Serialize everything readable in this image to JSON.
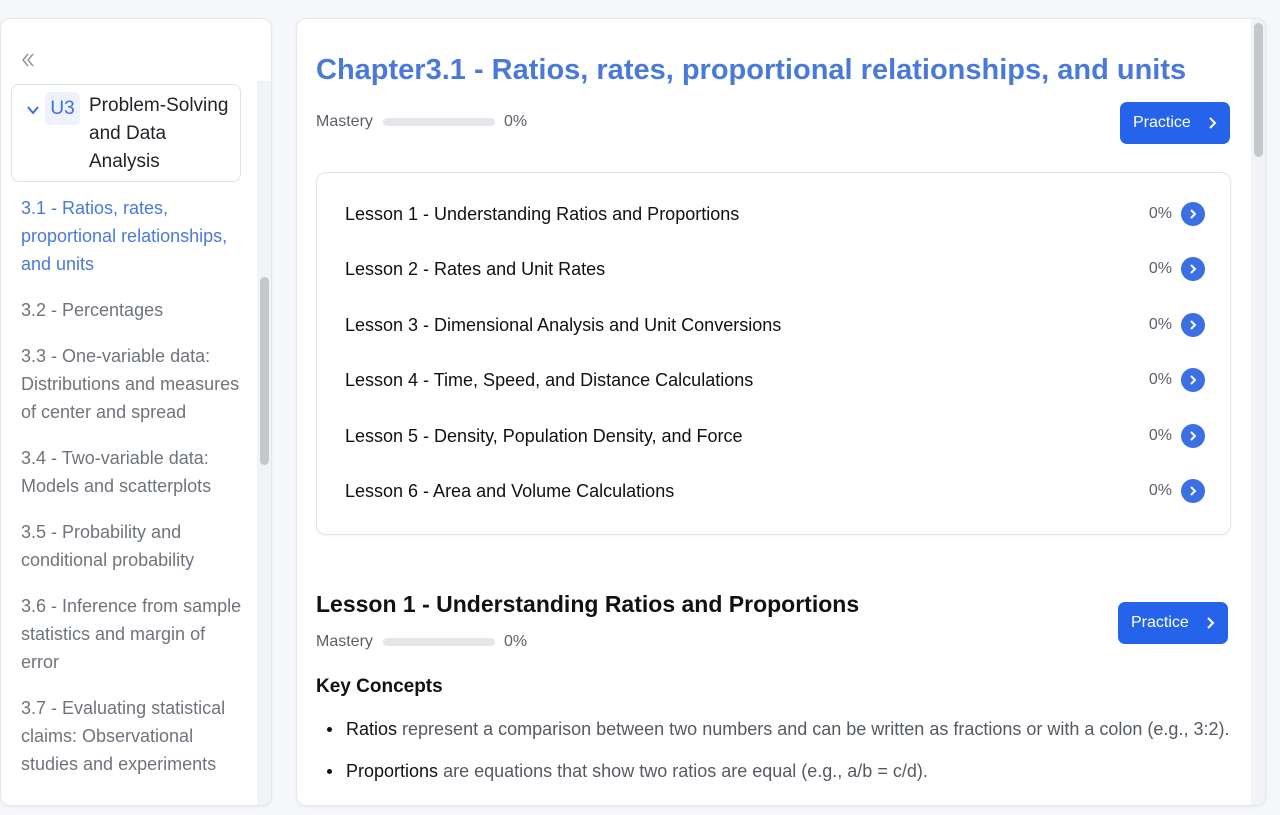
{
  "sidebar": {
    "collapse_icon": "double-chevron-left-icon",
    "unit": {
      "badge": "U3",
      "title": "Problem-Solving and Data Analysis",
      "expand_icon": "chevron-down-icon"
    },
    "chapters": [
      {
        "label": "3.1 - Ratios, rates, proportional relationships, and units",
        "active": true
      },
      {
        "label": "3.2 - Percentages",
        "active": false
      },
      {
        "label": "3.3 - One-variable data: Distributions and measures of center and spread",
        "active": false
      },
      {
        "label": "3.4 - Two-variable data: Models and scatterplots",
        "active": false
      },
      {
        "label": "3.5 - Probability and conditional probability",
        "active": false
      },
      {
        "label": "3.6 - Inference from sample statistics and margin of error",
        "active": false
      },
      {
        "label": "3.7 - Evaluating statistical claims: Observational studies and experiments",
        "active": false
      }
    ]
  },
  "main": {
    "chapter_title": "Chapter3.1 - Ratios, rates, proportional relationships, and units",
    "mastery_label": "Mastery",
    "mastery_value": "0%",
    "mastery_fraction": 0,
    "practice_label": "Practice",
    "lessons": [
      {
        "name": "Lesson 1 - Understanding Ratios and Proportions",
        "progress": "0%"
      },
      {
        "name": "Lesson 2 - Rates and Unit Rates",
        "progress": "0%"
      },
      {
        "name": "Lesson 3 - Dimensional Analysis and Unit Conversions",
        "progress": "0%"
      },
      {
        "name": "Lesson 4 - Time, Speed, and Distance Calculations",
        "progress": "0%"
      },
      {
        "name": "Lesson 5 - Density, Population Density, and Force",
        "progress": "0%"
      },
      {
        "name": "Lesson 6 - Area and Volume Calculations",
        "progress": "0%"
      }
    ],
    "lesson_section": {
      "title": "Lesson 1 - Understanding Ratios and Proportions",
      "mastery_label": "Mastery",
      "mastery_value": "0%",
      "mastery_fraction": 0,
      "practice_label": "Practice",
      "key_concepts_title": "Key Concepts",
      "concepts": [
        {
          "term": "Ratios",
          "text": " represent a comparison between two numbers and can be written as fractions or with a colon (e.g., 3:2)."
        },
        {
          "term": "Proportions",
          "text": " are equations that show two ratios are equal (e.g., a/b = c/d)."
        }
      ]
    }
  },
  "colors": {
    "accent": "#2563eb",
    "active_link": "#4a7ad9",
    "title": "#4a7ad9"
  }
}
